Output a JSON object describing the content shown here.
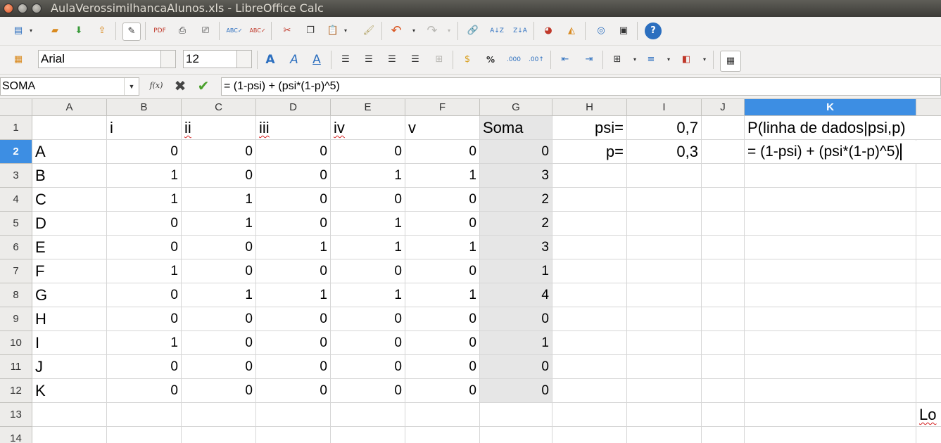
{
  "window": {
    "title": "AulaVerossimilhancaAlunos.xls - LibreOffice Calc"
  },
  "toolbar": {
    "font_name": "Arial",
    "font_size": "12"
  },
  "formula_bar": {
    "name_box": "SOMA",
    "function_wizard_label": "f(x)",
    "formula": "= (1-psi) + (psi*(1-p)^5)"
  },
  "sheet": {
    "columns": [
      "A",
      "B",
      "C",
      "D",
      "E",
      "F",
      "G",
      "H",
      "I",
      "J",
      "K"
    ],
    "active_column": "K",
    "active_row": "2",
    "rows": [
      {
        "n": "1",
        "A": "",
        "B": "i",
        "C": "ii",
        "D": "iii",
        "E": "iv",
        "F": "v",
        "G": "Soma",
        "H": "psi=",
        "I": "0,7",
        "K": "P(linha de dados|psi,p)"
      },
      {
        "n": "2",
        "A": "A",
        "B": "0",
        "C": "0",
        "D": "0",
        "E": "0",
        "F": "0",
        "G": "0",
        "H": "p=",
        "I": "0,3",
        "K": "= (1-psi) + (psi*(1-p)^5)"
      },
      {
        "n": "3",
        "A": "B",
        "B": "1",
        "C": "0",
        "D": "0",
        "E": "1",
        "F": "1",
        "G": "3"
      },
      {
        "n": "4",
        "A": "C",
        "B": "1",
        "C": "1",
        "D": "0",
        "E": "0",
        "F": "0",
        "G": "2"
      },
      {
        "n": "5",
        "A": "D",
        "B": "0",
        "C": "1",
        "D": "0",
        "E": "1",
        "F": "0",
        "G": "2"
      },
      {
        "n": "6",
        "A": "E",
        "B": "0",
        "C": "0",
        "D": "1",
        "E": "1",
        "F": "1",
        "G": "3"
      },
      {
        "n": "7",
        "A": "F",
        "B": "1",
        "C": "0",
        "D": "0",
        "E": "0",
        "F": "0",
        "G": "1"
      },
      {
        "n": "8",
        "A": "G",
        "B": "0",
        "C": "1",
        "D": "1",
        "E": "1",
        "F": "1",
        "G": "4"
      },
      {
        "n": "9",
        "A": "H",
        "B": "0",
        "C": "0",
        "D": "0",
        "E": "0",
        "F": "0",
        "G": "0"
      },
      {
        "n": "10",
        "A": "I",
        "B": "1",
        "C": "0",
        "D": "0",
        "E": "0",
        "F": "0",
        "G": "1"
      },
      {
        "n": "11",
        "A": "J",
        "B": "0",
        "C": "0",
        "D": "0",
        "E": "0",
        "F": "0",
        "G": "0"
      },
      {
        "n": "12",
        "A": "K",
        "B": "0",
        "C": "0",
        "D": "0",
        "E": "0",
        "F": "0",
        "G": "0"
      },
      {
        "n": "13",
        "L": "Lo"
      },
      {
        "n": "14"
      }
    ]
  }
}
